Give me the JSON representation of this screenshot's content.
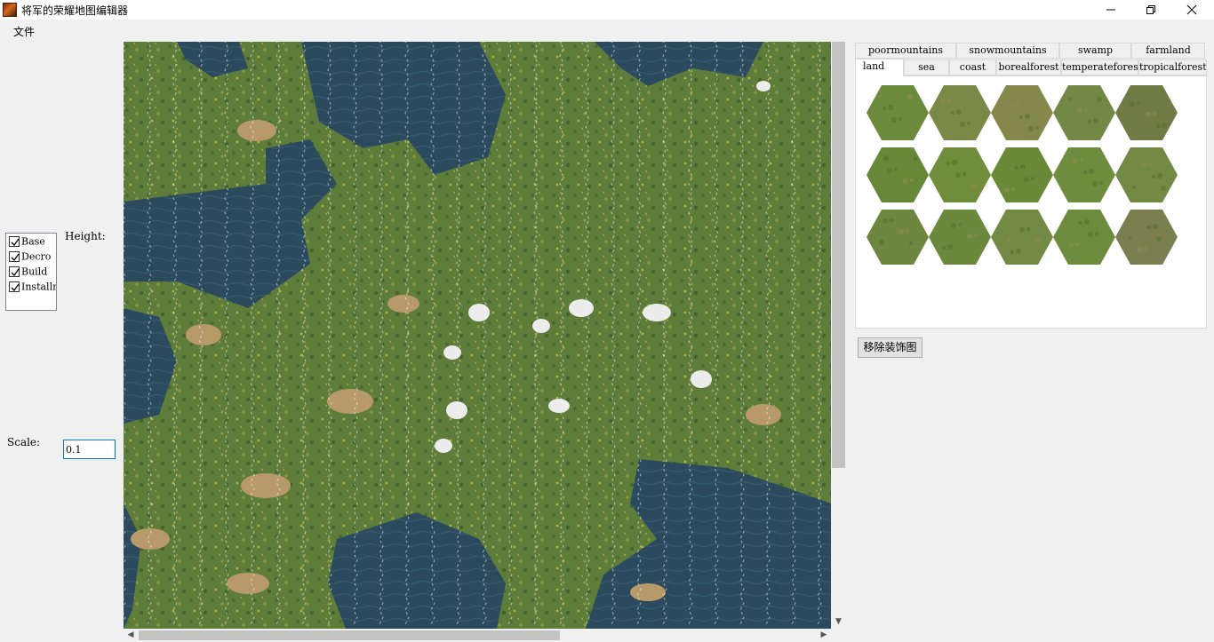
{
  "window": {
    "title": "将军的荣耀地图编辑器",
    "icon": "app-general-icon",
    "controls": [
      "minimize-icon",
      "restore-icon",
      "close-icon"
    ]
  },
  "menu": {
    "file": "文件"
  },
  "layers": {
    "items": [
      {
        "label": "Base",
        "checked": true
      },
      {
        "label": "Decro",
        "checked": true
      },
      {
        "label": "Build",
        "checked": true
      },
      {
        "label": "Installm",
        "checked": true
      }
    ]
  },
  "height": {
    "label": "Height:"
  },
  "scale": {
    "label": "Scale:",
    "value": "0.1"
  },
  "terrain_tabs": {
    "row1": [
      "poormountains",
      "snowmountains",
      "swamp",
      "farmland"
    ],
    "row2": [
      "land",
      "sea",
      "coast",
      "borealforest",
      "temperateforest",
      "tropicalforest"
    ],
    "active": "land"
  },
  "palette": {
    "tile_count": 15,
    "colors": [
      "#6b8a3c",
      "#7a8a46",
      "#84884a",
      "#748845",
      "#6f7a45",
      "#668838",
      "#6f8d3b",
      "#6a8a3a",
      "#6e8c3d",
      "#738a45",
      "#6e8740",
      "#6b893c",
      "#728a43",
      "#6d8b3d",
      "#7b7e4e"
    ]
  },
  "remove_decoration_button": {
    "label": "移除装饰图"
  },
  "colors": {
    "land": "#5f7d3a",
    "sea": "#2c4a5e",
    "mountain": "#b89a6a",
    "snow": "#ececec"
  }
}
